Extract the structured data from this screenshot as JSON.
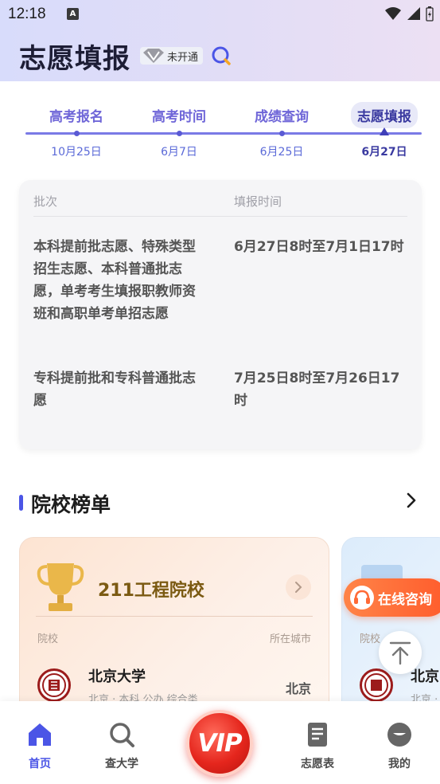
{
  "status_bar": {
    "time": "12:18",
    "notif": "A"
  },
  "header": {
    "title": "志愿填报",
    "vip_status": "未开通"
  },
  "tabs": [
    {
      "label": "高考报名",
      "date": "10月25日"
    },
    {
      "label": "高考时间",
      "date": "6月7日"
    },
    {
      "label": "成绩查询",
      "date": "6月25日"
    },
    {
      "label": "志愿填报",
      "date": "6月27日"
    }
  ],
  "schedule": {
    "headers": {
      "batch": "批次",
      "time": "填报时间"
    },
    "rows": [
      {
        "batch": "本科提前批志愿、特殊类型招生志愿、本科普通批志愿，单考考生填报职教师资班和高职单考单招志愿",
        "time": "6月27日8时至7月1日17时"
      },
      {
        "batch": "专科提前批和专科普通批志愿",
        "time": "7月25日8时至7月26日17时"
      }
    ]
  },
  "ranking": {
    "section_title": "院校榜单",
    "card1": {
      "title": "211工程院校",
      "col_school": "院校",
      "col_city": "所在城市",
      "school": "北京大学",
      "school_sub": "北京 · 本科 公办 综合类",
      "city": "北京"
    },
    "card2": {
      "col_school": "院校",
      "school": "北京",
      "school_sub": "北京 ·"
    }
  },
  "float": {
    "consult_label": "在线咨询"
  },
  "nav": {
    "home": "首页",
    "search": "查大学",
    "vip": "VIP",
    "form": "志愿表",
    "mine": "我的"
  },
  "colors": {
    "accent": "#4b55e6",
    "brand_orange": "#ff5c2c",
    "vip_red": "#e5261d"
  }
}
